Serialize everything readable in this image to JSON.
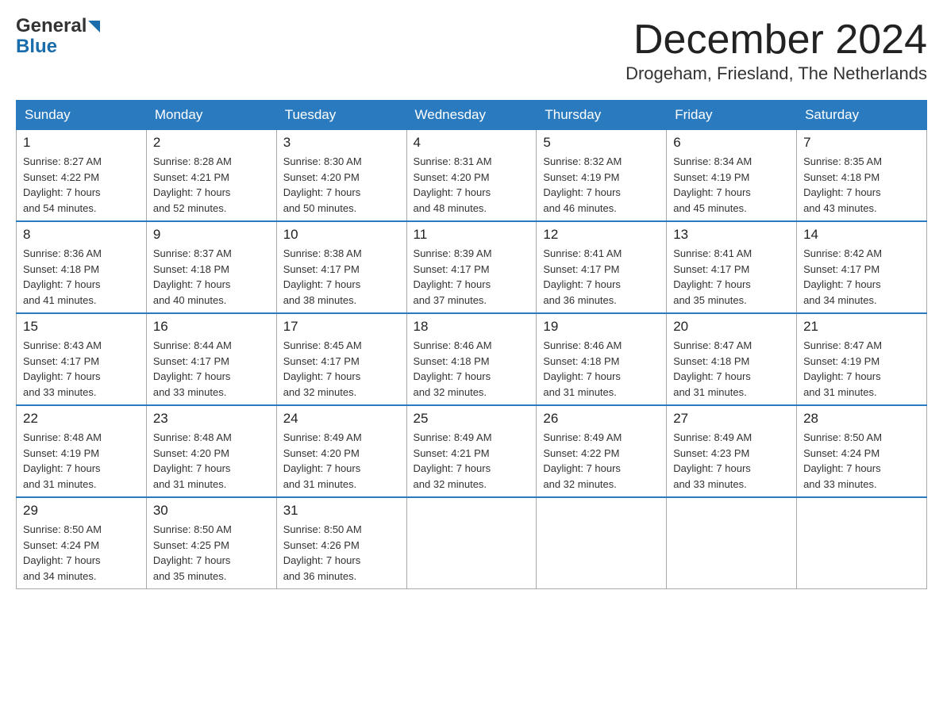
{
  "logo": {
    "text_general": "General",
    "text_blue": "Blue"
  },
  "header": {
    "title": "December 2024",
    "subtitle": "Drogeham, Friesland, The Netherlands"
  },
  "days_of_week": [
    "Sunday",
    "Monday",
    "Tuesday",
    "Wednesday",
    "Thursday",
    "Friday",
    "Saturday"
  ],
  "weeks": [
    [
      {
        "num": "1",
        "info": "Sunrise: 8:27 AM\nSunset: 4:22 PM\nDaylight: 7 hours\nand 54 minutes."
      },
      {
        "num": "2",
        "info": "Sunrise: 8:28 AM\nSunset: 4:21 PM\nDaylight: 7 hours\nand 52 minutes."
      },
      {
        "num": "3",
        "info": "Sunrise: 8:30 AM\nSunset: 4:20 PM\nDaylight: 7 hours\nand 50 minutes."
      },
      {
        "num": "4",
        "info": "Sunrise: 8:31 AM\nSunset: 4:20 PM\nDaylight: 7 hours\nand 48 minutes."
      },
      {
        "num": "5",
        "info": "Sunrise: 8:32 AM\nSunset: 4:19 PM\nDaylight: 7 hours\nand 46 minutes."
      },
      {
        "num": "6",
        "info": "Sunrise: 8:34 AM\nSunset: 4:19 PM\nDaylight: 7 hours\nand 45 minutes."
      },
      {
        "num": "7",
        "info": "Sunrise: 8:35 AM\nSunset: 4:18 PM\nDaylight: 7 hours\nand 43 minutes."
      }
    ],
    [
      {
        "num": "8",
        "info": "Sunrise: 8:36 AM\nSunset: 4:18 PM\nDaylight: 7 hours\nand 41 minutes."
      },
      {
        "num": "9",
        "info": "Sunrise: 8:37 AM\nSunset: 4:18 PM\nDaylight: 7 hours\nand 40 minutes."
      },
      {
        "num": "10",
        "info": "Sunrise: 8:38 AM\nSunset: 4:17 PM\nDaylight: 7 hours\nand 38 minutes."
      },
      {
        "num": "11",
        "info": "Sunrise: 8:39 AM\nSunset: 4:17 PM\nDaylight: 7 hours\nand 37 minutes."
      },
      {
        "num": "12",
        "info": "Sunrise: 8:41 AM\nSunset: 4:17 PM\nDaylight: 7 hours\nand 36 minutes."
      },
      {
        "num": "13",
        "info": "Sunrise: 8:41 AM\nSunset: 4:17 PM\nDaylight: 7 hours\nand 35 minutes."
      },
      {
        "num": "14",
        "info": "Sunrise: 8:42 AM\nSunset: 4:17 PM\nDaylight: 7 hours\nand 34 minutes."
      }
    ],
    [
      {
        "num": "15",
        "info": "Sunrise: 8:43 AM\nSunset: 4:17 PM\nDaylight: 7 hours\nand 33 minutes."
      },
      {
        "num": "16",
        "info": "Sunrise: 8:44 AM\nSunset: 4:17 PM\nDaylight: 7 hours\nand 33 minutes."
      },
      {
        "num": "17",
        "info": "Sunrise: 8:45 AM\nSunset: 4:17 PM\nDaylight: 7 hours\nand 32 minutes."
      },
      {
        "num": "18",
        "info": "Sunrise: 8:46 AM\nSunset: 4:18 PM\nDaylight: 7 hours\nand 32 minutes."
      },
      {
        "num": "19",
        "info": "Sunrise: 8:46 AM\nSunset: 4:18 PM\nDaylight: 7 hours\nand 31 minutes."
      },
      {
        "num": "20",
        "info": "Sunrise: 8:47 AM\nSunset: 4:18 PM\nDaylight: 7 hours\nand 31 minutes."
      },
      {
        "num": "21",
        "info": "Sunrise: 8:47 AM\nSunset: 4:19 PM\nDaylight: 7 hours\nand 31 minutes."
      }
    ],
    [
      {
        "num": "22",
        "info": "Sunrise: 8:48 AM\nSunset: 4:19 PM\nDaylight: 7 hours\nand 31 minutes."
      },
      {
        "num": "23",
        "info": "Sunrise: 8:48 AM\nSunset: 4:20 PM\nDaylight: 7 hours\nand 31 minutes."
      },
      {
        "num": "24",
        "info": "Sunrise: 8:49 AM\nSunset: 4:20 PM\nDaylight: 7 hours\nand 31 minutes."
      },
      {
        "num": "25",
        "info": "Sunrise: 8:49 AM\nSunset: 4:21 PM\nDaylight: 7 hours\nand 32 minutes."
      },
      {
        "num": "26",
        "info": "Sunrise: 8:49 AM\nSunset: 4:22 PM\nDaylight: 7 hours\nand 32 minutes."
      },
      {
        "num": "27",
        "info": "Sunrise: 8:49 AM\nSunset: 4:23 PM\nDaylight: 7 hours\nand 33 minutes."
      },
      {
        "num": "28",
        "info": "Sunrise: 8:50 AM\nSunset: 4:24 PM\nDaylight: 7 hours\nand 33 minutes."
      }
    ],
    [
      {
        "num": "29",
        "info": "Sunrise: 8:50 AM\nSunset: 4:24 PM\nDaylight: 7 hours\nand 34 minutes."
      },
      {
        "num": "30",
        "info": "Sunrise: 8:50 AM\nSunset: 4:25 PM\nDaylight: 7 hours\nand 35 minutes."
      },
      {
        "num": "31",
        "info": "Sunrise: 8:50 AM\nSunset: 4:26 PM\nDaylight: 7 hours\nand 36 minutes."
      },
      null,
      null,
      null,
      null
    ]
  ]
}
